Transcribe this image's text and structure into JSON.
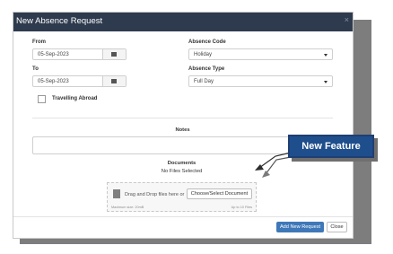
{
  "modal": {
    "title": "New Absence Request",
    "close_label": "×"
  },
  "form": {
    "from_label": "From",
    "from_value": "05-Sep-2023",
    "to_label": "To",
    "to_value": "05-Sep-2023",
    "absence_code_label": "Absence Code",
    "absence_code_value": "Holiday",
    "absence_type_label": "Absence Type",
    "absence_type_value": "Full Day",
    "travelling_abroad_label": "Travelling Abroad",
    "travelling_abroad_checked": false,
    "notes_label": "Notes",
    "notes_value": ""
  },
  "documents": {
    "title": "Documents",
    "status": "No Files Selected",
    "dropzone_text": "Drag and Drop files here or",
    "choose_button_label": "Choose/Select Document",
    "max_size_text": "Maximum size: 20mB",
    "max_files_text": "Up to 10 Files"
  },
  "footer": {
    "primary_button_label": "Add New Request",
    "close_button_label": "Close"
  },
  "callout": {
    "text": "New Feature",
    "color": "#1f4e8c"
  },
  "colors": {
    "header_bg": "#2e3b4e",
    "primary_button": "#3f78b8",
    "backdrop_shadow": "#7d7d7d"
  },
  "icons": {
    "calendar": "calendar-icon",
    "document": "document-icon",
    "dropdown": "chevron-down-icon",
    "close": "close-icon"
  }
}
